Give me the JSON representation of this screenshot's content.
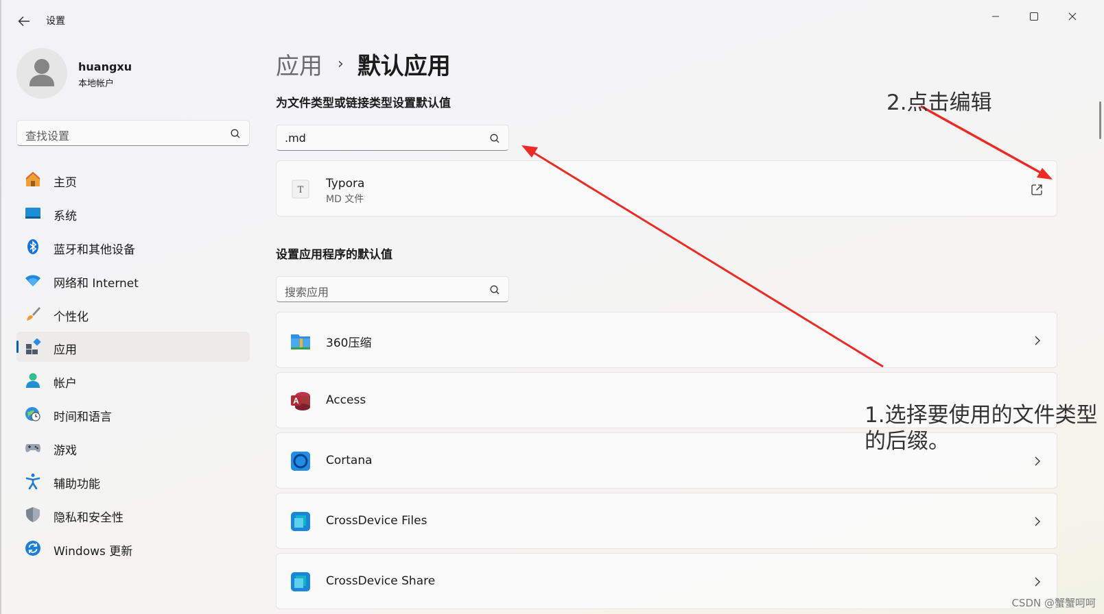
{
  "window": {
    "title": "设置"
  },
  "user": {
    "name": "huangxu",
    "account_type": "本地帐户"
  },
  "sidebar": {
    "search_placeholder": "查找设置",
    "items": [
      {
        "label": "主页",
        "icon": "home-icon"
      },
      {
        "label": "系统",
        "icon": "system-icon"
      },
      {
        "label": "蓝牙和其他设备",
        "icon": "bluetooth-icon"
      },
      {
        "label": "网络和 Internet",
        "icon": "wifi-icon"
      },
      {
        "label": "个性化",
        "icon": "brush-icon"
      },
      {
        "label": "应用",
        "icon": "apps-icon",
        "active": true
      },
      {
        "label": "帐户",
        "icon": "account-icon"
      },
      {
        "label": "时间和语言",
        "icon": "globe-clock-icon"
      },
      {
        "label": "游戏",
        "icon": "gamepad-icon"
      },
      {
        "label": "辅助功能",
        "icon": "accessibility-icon"
      },
      {
        "label": "隐私和安全性",
        "icon": "shield-icon"
      },
      {
        "label": "Windows 更新",
        "icon": "update-icon"
      }
    ]
  },
  "main": {
    "breadcrumb": {
      "parent": "应用",
      "separator": "›",
      "current": "默认应用"
    },
    "file_type_section": {
      "title": "为文件类型或链接类型设置默认值",
      "search_value": ".md",
      "result": {
        "app": "Typora",
        "type": "MD 文件",
        "action_icon": "open-external-icon"
      }
    },
    "app_section": {
      "title": "设置应用程序的默认值",
      "search_placeholder": "搜索应用",
      "apps": [
        {
          "name": "360压缩",
          "icon": "360zip-icon"
        },
        {
          "name": "Access",
          "icon": "access-icon"
        },
        {
          "name": "Cortana",
          "icon": "cortana-icon"
        },
        {
          "name": "CrossDevice Files",
          "icon": "crossdevice-icon"
        },
        {
          "name": "CrossDevice Share",
          "icon": "crossdevice-icon"
        }
      ]
    }
  },
  "annotations": {
    "step1_line1": "1.选择要使用的文件类型",
    "step1_line2": "的后缀。",
    "step2": "2.点击编辑",
    "arrow_color": "#ee2a24"
  },
  "watermark": "CSDN @蟹蟹呵呵",
  "colors": {
    "accent": "#005fb8",
    "annotation_red": "#ee2a24"
  }
}
